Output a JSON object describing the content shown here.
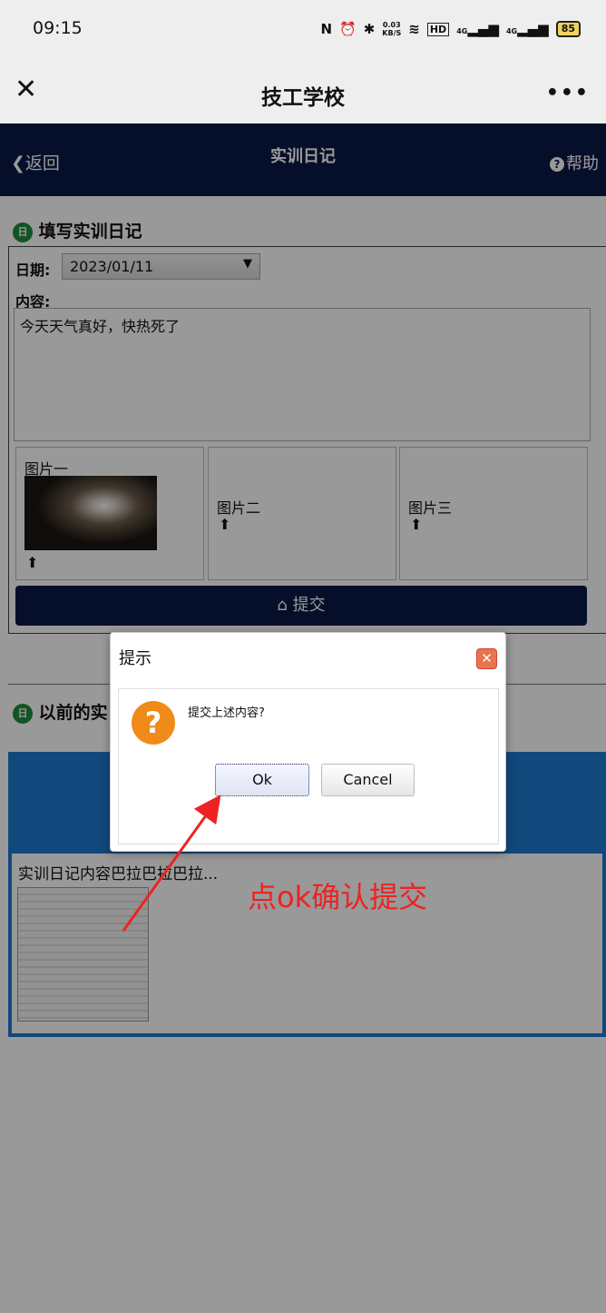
{
  "status_bar": {
    "time": "09:15",
    "net_speed_value": "0.03",
    "net_speed_unit": "KB/S",
    "hd_badge": "HD",
    "signal1_label": "4G",
    "signal2_label": "4G",
    "battery": "85",
    "icons": [
      "nfc-icon",
      "alarm-icon",
      "bluetooth-icon",
      "wifi-icon",
      "signal-icon",
      "battery-icon"
    ]
  },
  "wechat_nav": {
    "title": "技工学校",
    "close_glyph": "✕",
    "more_glyph": "•••"
  },
  "app_header": {
    "back_label": "返回",
    "title": "实训日记",
    "help_label": "帮助"
  },
  "form": {
    "section_title": "填写实训日记",
    "date_label": "日期:",
    "date_value": "2023/01/11",
    "content_label": "内容:",
    "content_value": "今天天气真好，快热死了",
    "images": [
      {
        "label": "图片一"
      },
      {
        "label": "图片二"
      },
      {
        "label": "图片三"
      }
    ],
    "submit_label": "提交"
  },
  "history": {
    "section_title": "以前的实",
    "item_title": "实训日记内容巴拉巴拉巴拉..."
  },
  "dialog": {
    "title": "提示",
    "message": "提交上述内容?",
    "ok_label": "Ok",
    "cancel_label": "Cancel"
  },
  "annotation": {
    "text": "点ok确认提交",
    "color": "#ee2222"
  },
  "colors": {
    "header_bg": "#0b1a47",
    "section_icon": "#1e8c3e",
    "list_accent": "#1e78cf",
    "question_icon": "#f08a18"
  }
}
